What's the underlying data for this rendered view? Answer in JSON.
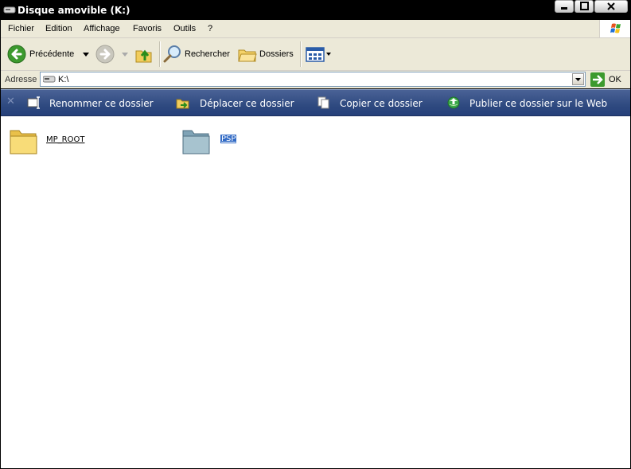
{
  "window": {
    "title": "Disque amovible (K:)"
  },
  "menu": {
    "items": [
      "Fichier",
      "Edition",
      "Affichage",
      "Favoris",
      "Outils",
      "?"
    ]
  },
  "toolbar": {
    "back_label": "Précédente",
    "search_label": "Rechercher",
    "folders_label": "Dossiers"
  },
  "address": {
    "label": "Adresse",
    "value": "K:\\",
    "go_label": "OK"
  },
  "tasks": {
    "rename": "Renommer ce dossier",
    "move": "Déplacer ce dossier",
    "copy": "Copier ce dossier",
    "publish": "Publier ce dossier sur le Web"
  },
  "files": [
    {
      "name": "MP_ROOT",
      "selected": false
    },
    {
      "name": "PSP",
      "selected": true
    }
  ],
  "colors": {
    "taskbar": "#2f4a80",
    "selection": "#316ac5",
    "toolbar_bg": "#ece9d8"
  }
}
